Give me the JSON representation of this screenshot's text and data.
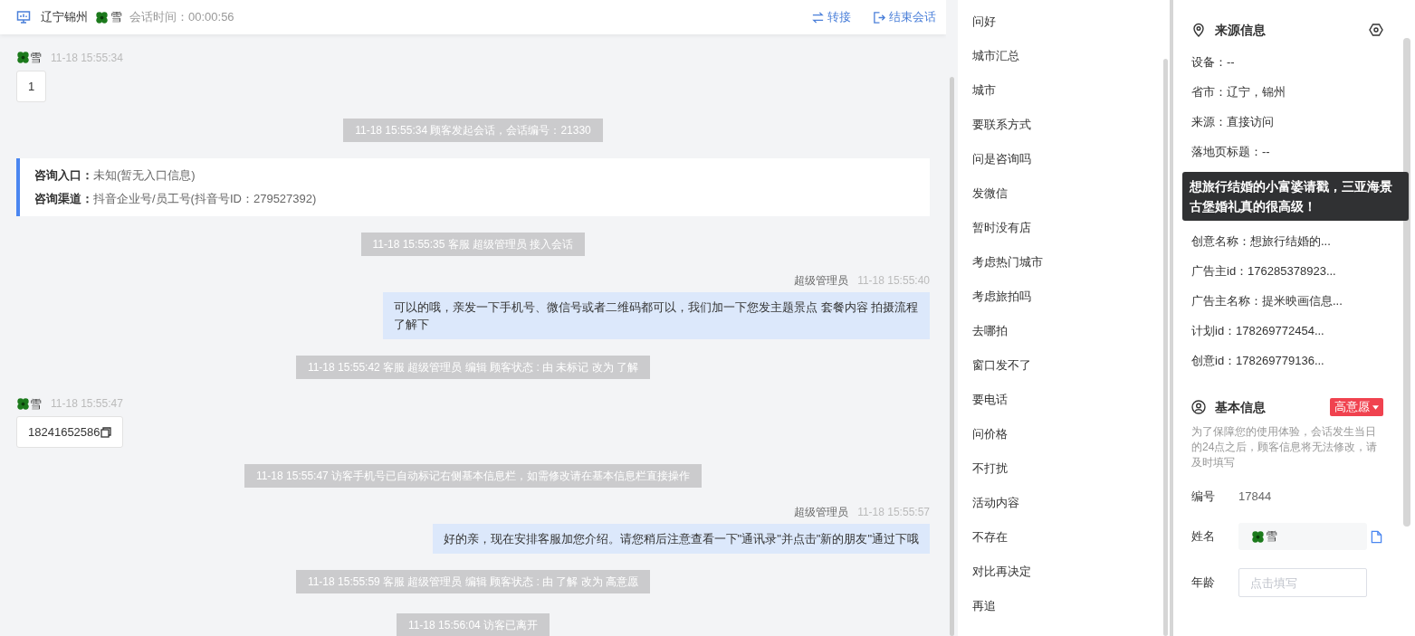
{
  "header": {
    "location": "辽宁锦州",
    "visitor": "雪",
    "session_time": "会话时间：00:00:56",
    "actions": [
      {
        "kind": "transfer",
        "label": "转接"
      },
      {
        "kind": "end",
        "label": "结束会话"
      }
    ]
  },
  "messages": [
    {
      "kind": "customer",
      "name": "雪",
      "time": "11-18 15:55:34",
      "text": "1",
      "copyable": false
    },
    {
      "kind": "system",
      "text": "11-18 15:55:34 顾客发起会话，会话编号：21330"
    },
    {
      "kind": "info",
      "lines": [
        {
          "label": "咨询入口：",
          "value": "未知(暂无入口信息)"
        },
        {
          "label": "咨询渠道：",
          "value": "抖音企业号/员工号(抖音号ID：279527392)"
        }
      ]
    },
    {
      "kind": "system",
      "text": "11-18 15:55:35 客服 超级管理员 接入会话"
    },
    {
      "kind": "agent",
      "name": "超级管理员",
      "time": "11-18 15:55:40",
      "text": "可以的哦，亲发一下手机号、微信号或者二维码都可以，我们加一下您发主题景点 套餐内容 拍摄流程了解下"
    },
    {
      "kind": "system",
      "text": "11-18 15:55:42 客服 超级管理员 编辑 顾客状态 : 由 未标记 改为 了解"
    },
    {
      "kind": "customer",
      "name": "雪",
      "time": "11-18 15:55:47",
      "text": "18241652586",
      "copyable": true
    },
    {
      "kind": "system",
      "text": "11-18 15:55:47 访客手机号已自动标记右侧基本信息栏，如需修改请在基本信息栏直接操作"
    },
    {
      "kind": "agent",
      "name": "超级管理员",
      "time": "11-18 15:55:57",
      "text": "好的亲，现在安排客服加您介绍。请您稍后注意查看一下\"通讯录\"并点击\"新的朋友\"通过下哦"
    },
    {
      "kind": "system",
      "text": "11-18 15:55:59 客服 超级管理员 编辑 顾客状态 : 由 了解 改为 高意愿"
    },
    {
      "kind": "system",
      "text": "11-18 15:56:04 访客已离开"
    }
  ],
  "quick_replies": [
    "问好",
    "城市汇总",
    "城市",
    "要联系方式",
    "问是咨询吗",
    "发微信",
    "暂时没有店",
    "考虑热门城市",
    "考虑旅拍吗",
    "去哪拍",
    "窗口发不了",
    "要电话",
    "问价格",
    "不打扰",
    "活动内容",
    "不存在",
    "对比再决定",
    "再追"
  ],
  "source_info": {
    "title": "来源信息",
    "items": [
      "设备：--",
      "省市：辽宁，锦州",
      "来源：直接访问",
      "落地页标题：--",
      "创意名称：想旅行结婚的...",
      "广告主id：176285378923...",
      "广告主名称：提米映画信息...",
      "计划id：178269772454...",
      "创意id：178269779136..."
    ],
    "tooltip": "想旅行结婚的小富婆请戳，三亚海景古堡婚礼真的很高级！"
  },
  "basic_info": {
    "title": "基本信息",
    "intent_tag": "高意愿",
    "notice": "为了保障您的使用体验，会话发生当日的24点之后，顾客信息将无法修改，请及时填写",
    "fields": [
      {
        "kind": "text",
        "label": "编号",
        "value": "17844"
      },
      {
        "kind": "name",
        "label": "姓名",
        "value": "雪"
      },
      {
        "kind": "input",
        "label": "年龄",
        "placeholder": "点击填写"
      }
    ]
  }
}
